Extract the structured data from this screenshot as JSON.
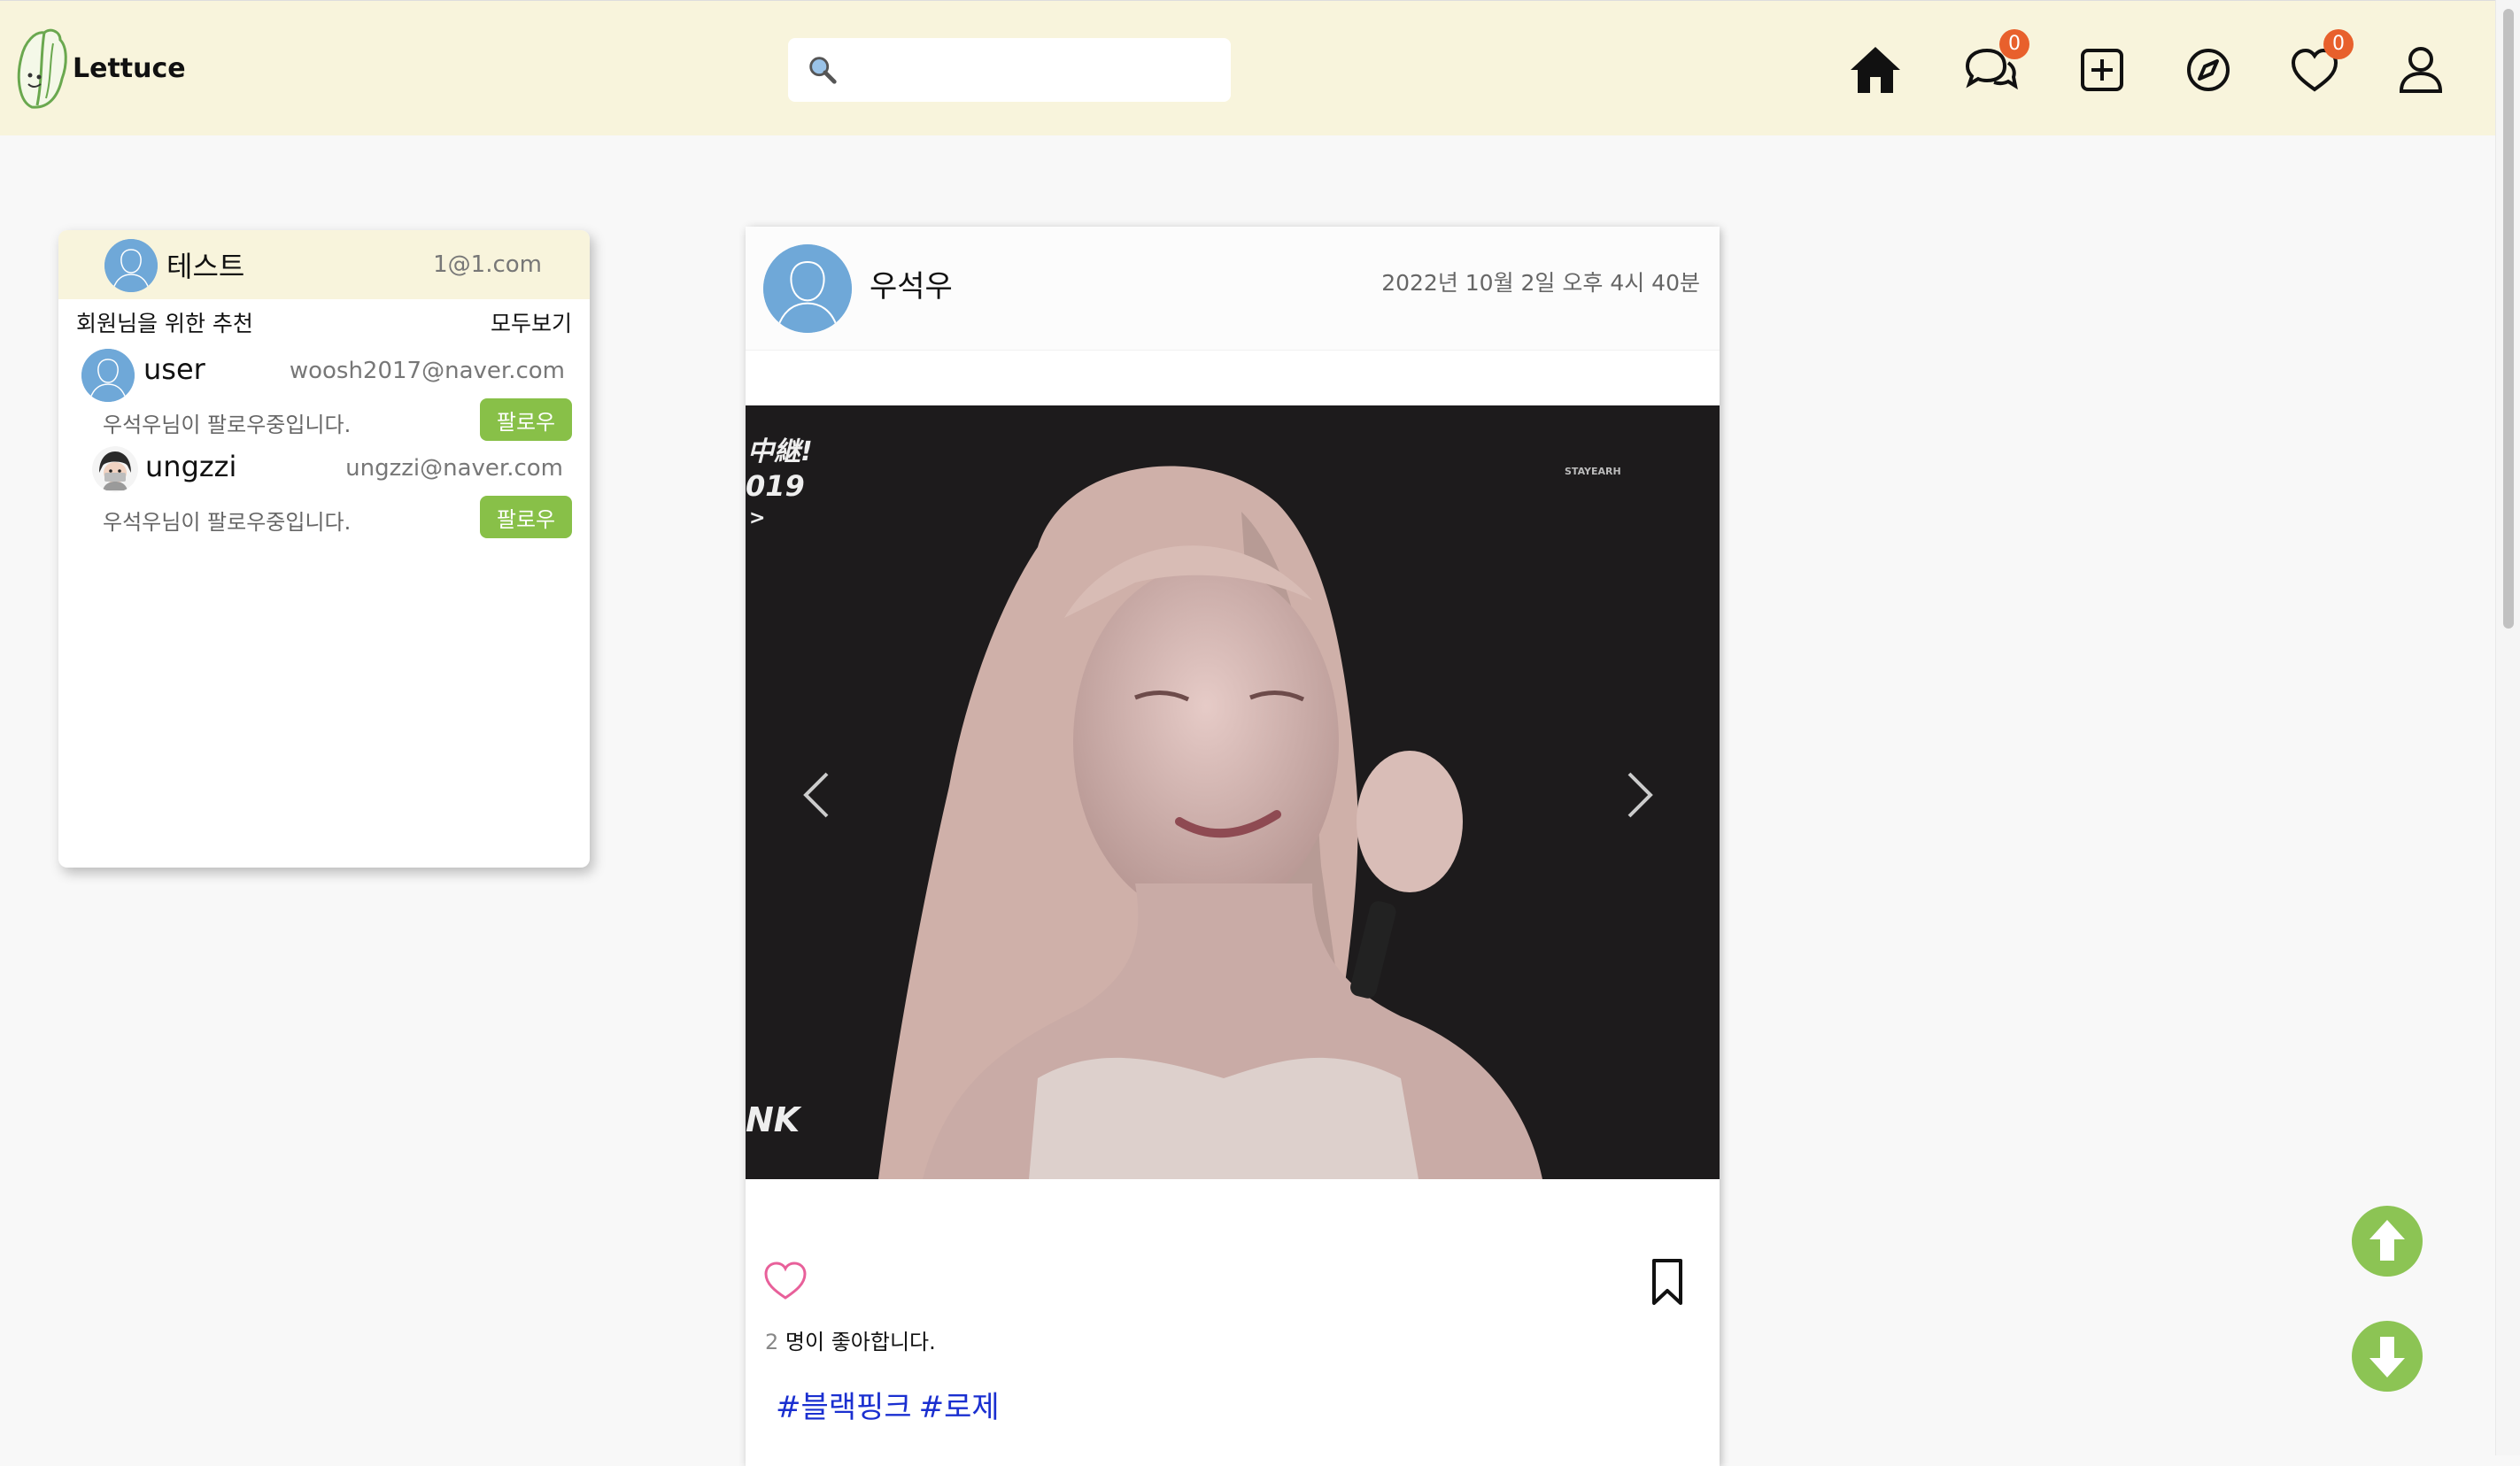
{
  "app": {
    "name": "Lettuce"
  },
  "search": {
    "placeholder": "",
    "value": ""
  },
  "nav": {
    "messages_badge": "0",
    "likes_badge": "0"
  },
  "me": {
    "name": "테스트",
    "email": "1@1.com"
  },
  "recommend": {
    "title": "회원님을 위한 추천",
    "see_all": "모두보기",
    "items": [
      {
        "name": "user",
        "email": "woosh2017@naver.com",
        "sub": "우석우님이 팔로우중입니다.",
        "follow_label": "팔로우"
      },
      {
        "name": "ungzzi",
        "email": "ungzzi@naver.com",
        "sub": "우석우님이 팔로우중입니다.",
        "follow_label": "팔로우"
      }
    ]
  },
  "post": {
    "author": "우석우",
    "date": "2022년 10월 2일 오후 4시 40분",
    "image_text": {
      "top_left": "中継!",
      "year": "019",
      "arrow": ">",
      "bottom_left": "NK",
      "watermark": "STAYEARH"
    },
    "likes_count": "2",
    "likes_suffix": "명이 좋아합니다.",
    "tags": [
      "#블랙핑크",
      "#로제"
    ]
  },
  "colors": {
    "header_bg": "#f8f4dc",
    "accent_green": "#88c048",
    "badge": "#e8602c",
    "tag_blue": "#1a2fd0",
    "like_pink": "#e8609a"
  }
}
